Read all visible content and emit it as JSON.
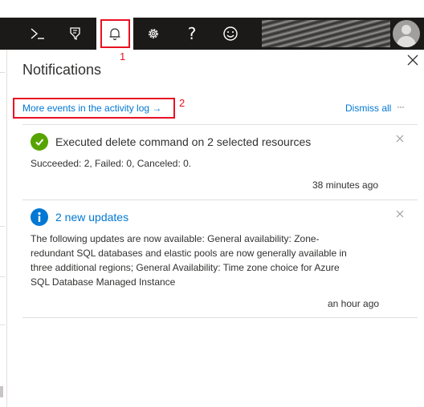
{
  "topbar": {
    "items": [
      {
        "name": "cloud-shell",
        "glyph": "❯_"
      },
      {
        "name": "directory-filter"
      },
      {
        "name": "notifications"
      },
      {
        "name": "settings"
      },
      {
        "name": "help",
        "glyph": "?"
      },
      {
        "name": "feedback"
      }
    ],
    "icons": {
      "cloud_shell": "cloud-shell-icon",
      "directory": "directory-filter-icon",
      "notifications": "bell-icon",
      "settings": "gear-icon",
      "help": "help-icon",
      "feedback": "smiley-icon",
      "avatar": "user-avatar"
    },
    "colors": {
      "background": "#1b1a19",
      "active": "#ffffff"
    }
  },
  "annotations": {
    "callout_1": "1",
    "callout_2": "2",
    "color": "#e81123"
  },
  "panel": {
    "title": "Notifications",
    "more_events_link": "More events in the activity log →",
    "dismiss_all": "Dismiss all",
    "more_options": "···",
    "accent": "#0078d4"
  },
  "notifications": [
    {
      "icon": "success-check-icon",
      "icon_color": "#57a300",
      "title": "Executed delete command on 2 selected resources",
      "body": "Succeeded: 2, Failed: 0, Canceled: 0.",
      "time": "38 minutes ago"
    },
    {
      "icon": "info-icon",
      "icon_color": "#0078d4",
      "title": "2 new updates",
      "title_color": "#0078d4",
      "body_lines": [
        "The following updates are now available: General availability: Zone-",
        "redundant SQL databases and elastic pools are now generally available in",
        "three additional regions; General Availability: Time zone choice for Azure",
        "SQL Database Managed Instance"
      ],
      "time": "an hour ago"
    }
  ]
}
